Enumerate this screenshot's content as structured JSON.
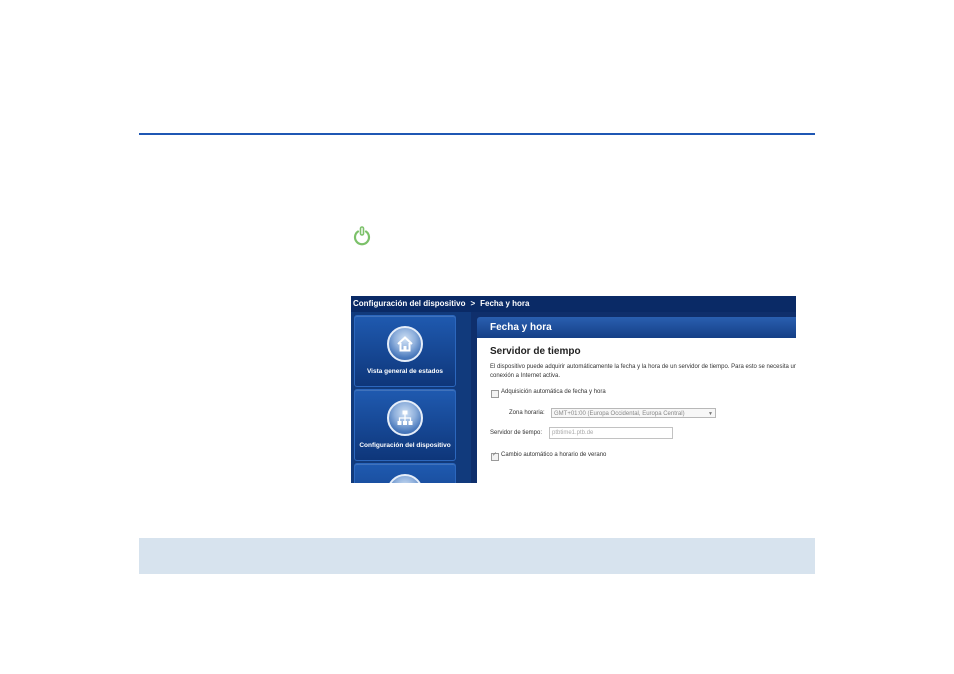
{
  "colors": {
    "rule": "#1f57b4",
    "band": "#d7e3ee",
    "icon": "#7cc16a",
    "navy": "#0f2f6c"
  },
  "icons": {
    "page_icon": "power-icon"
  },
  "screenshot": {
    "breadcrumb": {
      "first": "Configuración del dispositivo",
      "separator": ">",
      "current": "Fecha y hora"
    },
    "nav": [
      {
        "label": "Vista general de estados",
        "icon": "home-icon"
      },
      {
        "label": "Configuración del dispositivo",
        "icon": "network-icon"
      },
      {
        "label": "",
        "icon": "globe-icon"
      }
    ],
    "panel_title": "Fecha y hora",
    "section_title": "Servidor de tiempo",
    "description": "El dispositivo puede adquirir automáticamente la fecha y la hora de un servidor de tiempo. Para esto se necesita una conexión a Internet activa.",
    "auto_date_label": "Adquisición automática de fecha y hora",
    "auto_date_checked": false,
    "timezone_label": "Zona horaria:",
    "timezone_value": "GMT+01:00 (Europa Occidental, Europa Central)",
    "server_label": "Servidor de tiempo:",
    "server_value": "ptbtime1.ptb.de",
    "dst_label": "Cambio automático a horario de verano",
    "dst_checked": true
  }
}
